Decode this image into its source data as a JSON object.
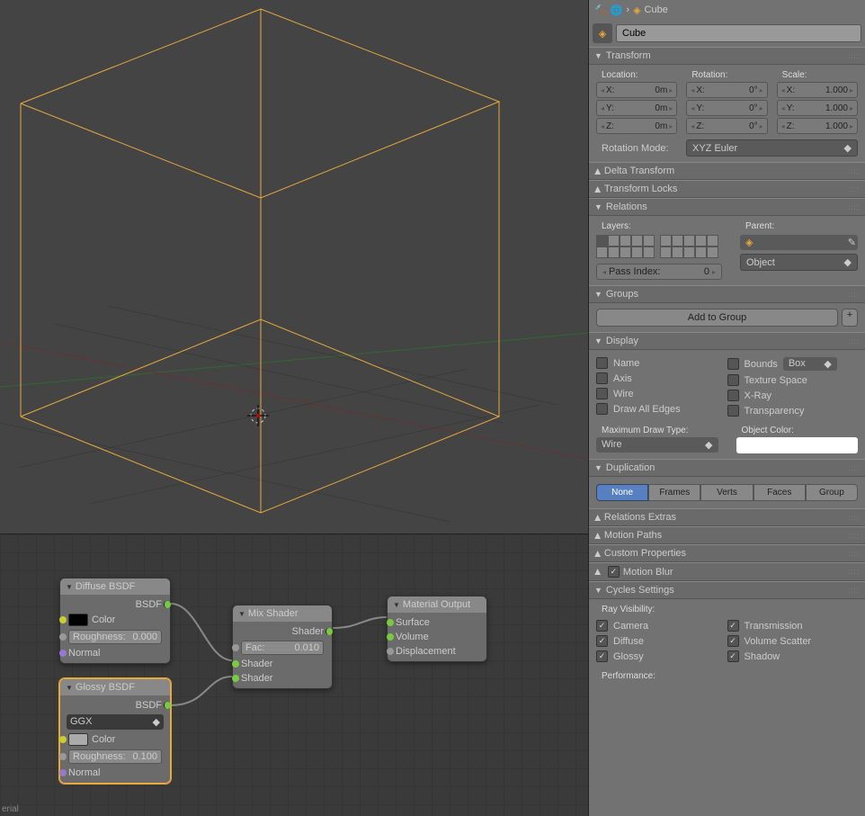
{
  "breadcrumb": {
    "object": "Cube"
  },
  "object_name": "Cube",
  "panels": {
    "transform": {
      "title": "Transform",
      "location_label": "Location:",
      "rotation_label": "Rotation:",
      "scale_label": "Scale:",
      "loc": {
        "x": "0m",
        "y": "0m",
        "z": "0m"
      },
      "rot": {
        "x": "0°",
        "y": "0°",
        "z": "0°"
      },
      "scale": {
        "x": "1.000",
        "y": "1.000",
        "z": "1.000"
      },
      "rot_mode_label": "Rotation Mode:",
      "rot_mode": "XYZ Euler"
    },
    "delta_transform": {
      "title": "Delta Transform"
    },
    "transform_locks": {
      "title": "Transform Locks"
    },
    "relations": {
      "title": "Relations",
      "layers_label": "Layers:",
      "parent_label": "Parent:",
      "parent_type": "Object",
      "pass_index_label": "Pass Index:",
      "pass_index": "0"
    },
    "groups": {
      "title": "Groups",
      "add_btn": "Add to Group",
      "plus": "+"
    },
    "display": {
      "title": "Display",
      "name": "Name",
      "axis": "Axis",
      "wire": "Wire",
      "draw_all": "Draw All Edges",
      "bounds": "Bounds",
      "bounds_type": "Box",
      "texture_space": "Texture Space",
      "xray": "X-Ray",
      "transparency": "Transparency",
      "max_draw_label": "Maximum Draw Type:",
      "max_draw": "Wire",
      "obj_color_label": "Object Color:"
    },
    "duplication": {
      "title": "Duplication",
      "tabs": [
        "None",
        "Frames",
        "Verts",
        "Faces",
        "Group"
      ],
      "active": "None"
    },
    "relations_extras": {
      "title": "Relations Extras"
    },
    "motion_paths": {
      "title": "Motion Paths"
    },
    "custom_props": {
      "title": "Custom Properties"
    },
    "motion_blur": {
      "title": "Motion Blur"
    },
    "cycles": {
      "title": "Cycles Settings",
      "ray_vis_label": "Ray Visibility:",
      "camera": "Camera",
      "diffuse": "Diffuse",
      "glossy": "Glossy",
      "transmission": "Transmission",
      "volume_scatter": "Volume Scatter",
      "shadow": "Shadow",
      "performance_label": "Performance:"
    }
  },
  "nodes": {
    "diffuse": {
      "title": "Diffuse BSDF",
      "out": "BSDF",
      "color": "Color",
      "roughness_label": "Roughness:",
      "roughness": "0.000",
      "normal": "Normal"
    },
    "glossy": {
      "title": "Glossy BSDF",
      "out": "BSDF",
      "dist": "GGX",
      "color": "Color",
      "roughness_label": "Roughness:",
      "roughness": "0.100",
      "normal": "Normal"
    },
    "mix": {
      "title": "Mix Shader",
      "out": "Shader",
      "fac_label": "Fac:",
      "fac": "0.010",
      "shader1": "Shader",
      "shader2": "Shader"
    },
    "output": {
      "title": "Material Output",
      "surface": "Surface",
      "volume": "Volume",
      "displacement": "Displacement"
    }
  },
  "footer": "erial",
  "axis_labels": {
    "x": "X:",
    "y": "Y:",
    "z": "Z:"
  }
}
